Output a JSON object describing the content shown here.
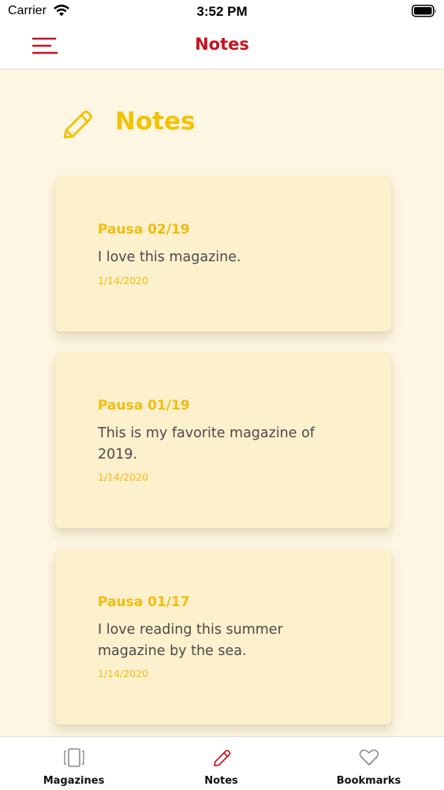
{
  "status_bar": {
    "carrier": "Carrier",
    "time": "3:52 PM"
  },
  "nav": {
    "title": "Notes"
  },
  "page": {
    "title": "Notes"
  },
  "notes": [
    {
      "title": "Pausa 02/19",
      "text": "I love this magazine.",
      "date": "1/14/2020"
    },
    {
      "title": "Pausa 01/19",
      "text": "This is my favorite magazine of 2019.",
      "date": "1/14/2020"
    },
    {
      "title": "Pausa 01/17",
      "text": "I love reading this summer magazine by the sea.",
      "date": "1/14/2020"
    }
  ],
  "tabs": [
    {
      "label": "Magazines",
      "icon": "magazines-icon",
      "active": false
    },
    {
      "label": "Notes",
      "icon": "pencil-icon",
      "active": true
    },
    {
      "label": "Bookmarks",
      "icon": "heart-icon",
      "active": false
    }
  ],
  "colors": {
    "accent_red": "#c8141e",
    "accent_yellow": "#f4c200",
    "background": "#fdf6e2",
    "card": "#fdf0cc"
  }
}
